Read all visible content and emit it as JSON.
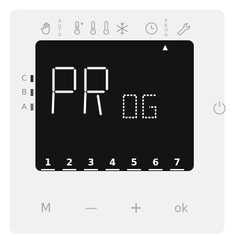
{
  "mode_icons": [
    "hand-icon",
    "auto-text",
    "thermometer-plus-icon",
    "thermometer-icon",
    "thermometer-low-icon",
    "snowflake-icon",
    "clock-icon",
    "prog-text",
    "wrench-icon"
  ],
  "auto_label": [
    "A",
    "U",
    "T",
    "O"
  ],
  "prog_label": [
    "P",
    "R",
    "O",
    "G"
  ],
  "display": {
    "main_text": "PR",
    "sub_text": "OG",
    "days": [
      "1",
      "2",
      "3",
      "4",
      "5",
      "6",
      "7"
    ],
    "indicator": "▲"
  },
  "zones": [
    "C",
    "B",
    "A"
  ],
  "buttons": {
    "mode": "M",
    "minus": "—",
    "plus": "+",
    "ok": "ok"
  },
  "colors": {
    "screen": "#141414",
    "segment": "#ffffff",
    "panel": "#f1f1f1",
    "icon": "#a0a0a0"
  }
}
